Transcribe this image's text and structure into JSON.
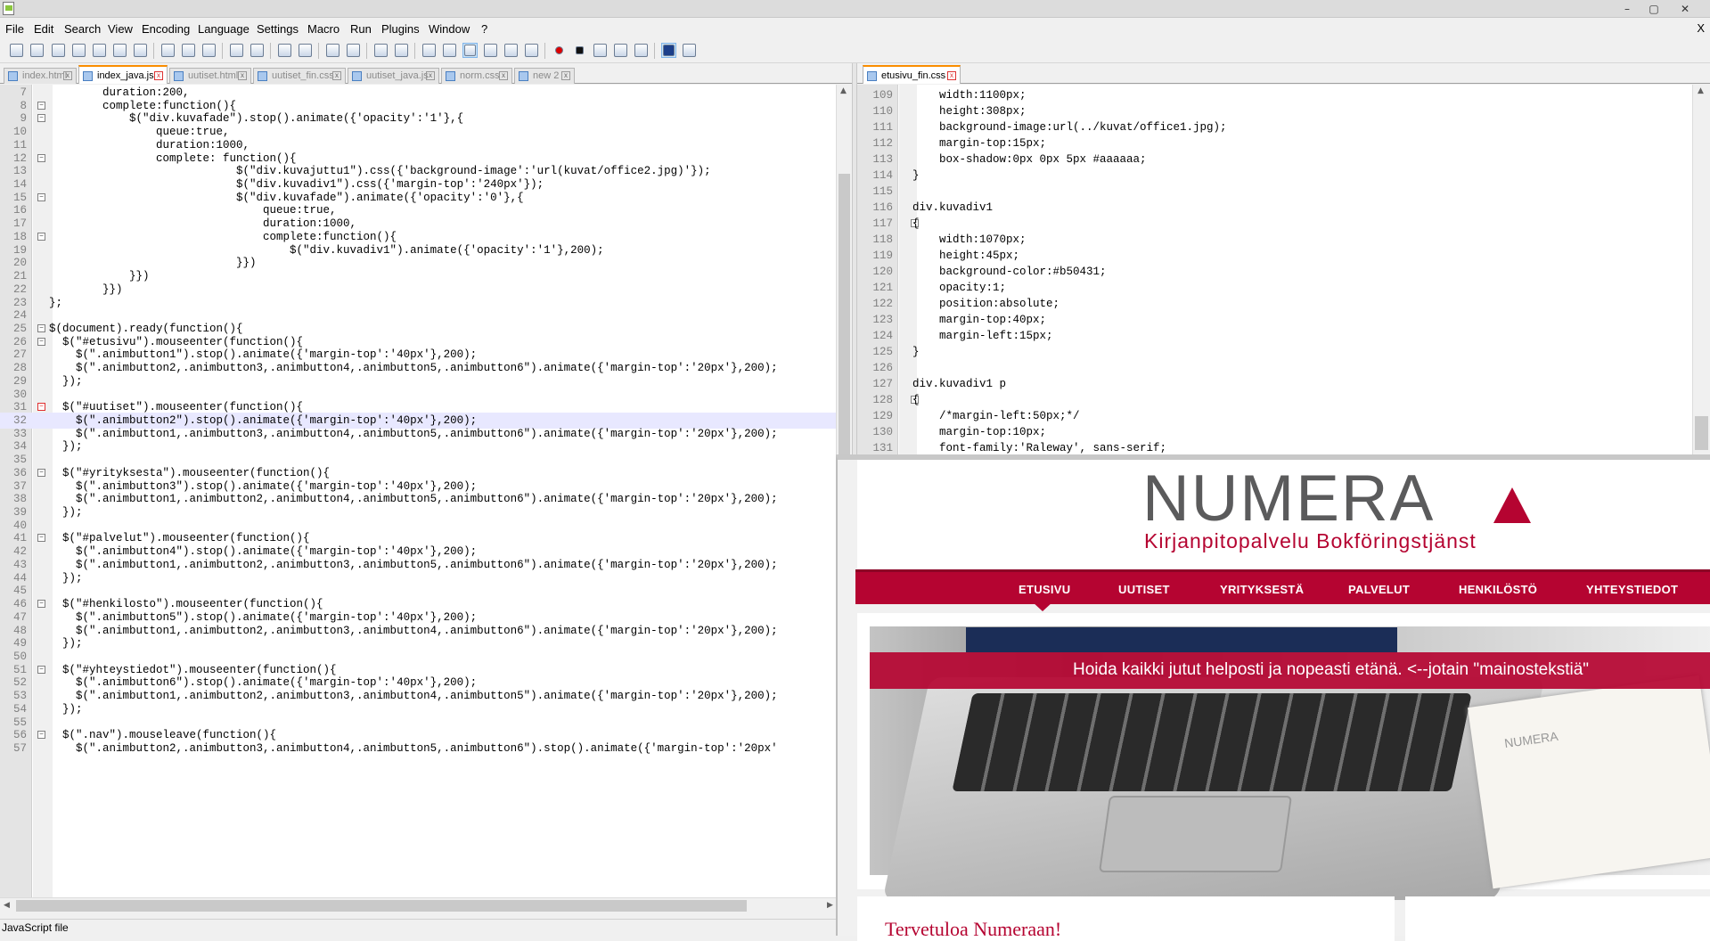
{
  "window": {
    "icon": "notepad-plus-plus-icon",
    "controls": {
      "minimize": "–",
      "maximize": "▢",
      "close": "✕"
    }
  },
  "menubar": {
    "items": [
      "File",
      "Edit",
      "Search",
      "View",
      "Encoding",
      "Language",
      "Settings",
      "Macro",
      "Run",
      "Plugins",
      "Window",
      "?"
    ],
    "close_x": "X"
  },
  "tabs_left": [
    {
      "label": "index.html",
      "active": false
    },
    {
      "label": "index_java.js",
      "active": true
    },
    {
      "label": "uutiset.html",
      "active": false
    },
    {
      "label": "uutiset_fin.css",
      "active": false
    },
    {
      "label": "uutiset_java.js",
      "active": false
    },
    {
      "label": "norm.css",
      "active": false
    },
    {
      "label": "new  2",
      "active": false
    }
  ],
  "tabs_right": [
    {
      "label": "etusivu_fin.css",
      "active": true
    }
  ],
  "left_editor": {
    "lines": [
      {
        "n": "7",
        "t": "        duration:200,"
      },
      {
        "n": "8",
        "t": "        complete:function(){"
      },
      {
        "n": "9",
        "t": "            $(\"div.kuvafade\").stop().animate({'opacity':'1'},{"
      },
      {
        "n": "10",
        "t": "                queue:true,"
      },
      {
        "n": "11",
        "t": "                duration:1000,"
      },
      {
        "n": "12",
        "t": "                complete: function(){"
      },
      {
        "n": "13",
        "t": "                            $(\"div.kuvajuttu1\").css({'background-image':'url(kuvat/office2.jpg)'});"
      },
      {
        "n": "14",
        "t": "                            $(\"div.kuvadiv1\").css({'margin-top':'240px'});"
      },
      {
        "n": "15",
        "t": "                            $(\"div.kuvafade\").animate({'opacity':'0'},{"
      },
      {
        "n": "16",
        "t": "                                queue:true,"
      },
      {
        "n": "17",
        "t": "                                duration:1000,"
      },
      {
        "n": "18",
        "t": "                                complete:function(){"
      },
      {
        "n": "19",
        "t": "                                    $(\"div.kuvadiv1\").animate({'opacity':'1'},200);"
      },
      {
        "n": "20",
        "t": "                            }})"
      },
      {
        "n": "21",
        "t": "            }})"
      },
      {
        "n": "22",
        "t": "        }})"
      },
      {
        "n": "23",
        "t": "};"
      },
      {
        "n": "24",
        "t": ""
      },
      {
        "n": "25",
        "t": "$(document).ready(function(){"
      },
      {
        "n": "26",
        "t": "  $(\"#etusivu\").mouseenter(function(){"
      },
      {
        "n": "27",
        "t": "    $(\".animbutton1\").stop().animate({'margin-top':'40px'},200);"
      },
      {
        "n": "28",
        "t": "    $(\".animbutton2,.animbutton3,.animbutton4,.animbutton5,.animbutton6\").animate({'margin-top':'20px'},200);"
      },
      {
        "n": "29",
        "t": "  });"
      },
      {
        "n": "30",
        "t": ""
      },
      {
        "n": "31",
        "t": "  $(\"#uutiset\").mouseenter(function(){"
      },
      {
        "n": "32",
        "t": "    $(\".animbutton2\").stop().animate({'margin-top':'40px'},200);"
      },
      {
        "n": "33",
        "t": "    $(\".animbutton1,.animbutton3,.animbutton4,.animbutton5,.animbutton6\").animate({'margin-top':'20px'},200);"
      },
      {
        "n": "34",
        "t": "  });"
      },
      {
        "n": "35",
        "t": ""
      },
      {
        "n": "36",
        "t": "  $(\"#yrityksesta\").mouseenter(function(){"
      },
      {
        "n": "37",
        "t": "    $(\".animbutton3\").stop().animate({'margin-top':'40px'},200);"
      },
      {
        "n": "38",
        "t": "    $(\".animbutton1,.animbutton2,.animbutton4,.animbutton5,.animbutton6\").animate({'margin-top':'20px'},200);"
      },
      {
        "n": "39",
        "t": "  });"
      },
      {
        "n": "40",
        "t": ""
      },
      {
        "n": "41",
        "t": "  $(\"#palvelut\").mouseenter(function(){"
      },
      {
        "n": "42",
        "t": "    $(\".animbutton4\").stop().animate({'margin-top':'40px'},200);"
      },
      {
        "n": "43",
        "t": "    $(\".animbutton1,.animbutton2,.animbutton3,.animbutton5,.animbutton6\").animate({'margin-top':'20px'},200);"
      },
      {
        "n": "44",
        "t": "  });"
      },
      {
        "n": "45",
        "t": ""
      },
      {
        "n": "46",
        "t": "  $(\"#henkilosto\").mouseenter(function(){"
      },
      {
        "n": "47",
        "t": "    $(\".animbutton5\").stop().animate({'margin-top':'40px'},200);"
      },
      {
        "n": "48",
        "t": "    $(\".animbutton1,.animbutton2,.animbutton3,.animbutton4,.animbutton6\").animate({'margin-top':'20px'},200);"
      },
      {
        "n": "49",
        "t": "  });"
      },
      {
        "n": "50",
        "t": ""
      },
      {
        "n": "51",
        "t": "  $(\"#yhteystiedot\").mouseenter(function(){"
      },
      {
        "n": "52",
        "t": "    $(\".animbutton6\").stop().animate({'margin-top':'40px'},200);"
      },
      {
        "n": "53",
        "t": "    $(\".animbutton1,.animbutton2,.animbutton3,.animbutton4,.animbutton5\").animate({'margin-top':'20px'},200);"
      },
      {
        "n": "54",
        "t": "  });"
      },
      {
        "n": "55",
        "t": ""
      },
      {
        "n": "56",
        "t": "  $(\".nav\").mouseleave(function(){"
      },
      {
        "n": "57",
        "t": "    $(\".animbutton2,.animbutton3,.animbutton4,.animbutton5,.animbutton6\").stop().animate({'margin-top':'20px'"
      }
    ],
    "fold_lines": [
      "8",
      "9",
      "12",
      "15",
      "18",
      "25",
      "26",
      "31",
      "36",
      "41",
      "46",
      "51",
      "56"
    ],
    "highlighted_line": "32"
  },
  "right_editor": {
    "lines": [
      {
        "n": "109",
        "t": "    width:1100px;"
      },
      {
        "n": "110",
        "t": "    height:308px;"
      },
      {
        "n": "111",
        "t": "    background-image:url(../kuvat/office1.jpg);"
      },
      {
        "n": "112",
        "t": "    margin-top:15px;"
      },
      {
        "n": "113",
        "t": "    box-shadow:0px 0px 5px #aaaaaa;"
      },
      {
        "n": "114",
        "t": "}"
      },
      {
        "n": "115",
        "t": ""
      },
      {
        "n": "116",
        "t": "div.kuvadiv1"
      },
      {
        "n": "117",
        "t": "{"
      },
      {
        "n": "118",
        "t": "    width:1070px;"
      },
      {
        "n": "119",
        "t": "    height:45px;"
      },
      {
        "n": "120",
        "t": "    background-color:#b50431;"
      },
      {
        "n": "121",
        "t": "    opacity:1;"
      },
      {
        "n": "122",
        "t": "    position:absolute;"
      },
      {
        "n": "123",
        "t": "    margin-top:40px;"
      },
      {
        "n": "124",
        "t": "    margin-left:15px;"
      },
      {
        "n": "125",
        "t": "}"
      },
      {
        "n": "126",
        "t": ""
      },
      {
        "n": "127",
        "t": "div.kuvadiv1 p"
      },
      {
        "n": "128",
        "t": "{"
      },
      {
        "n": "129",
        "t": "    /*margin-left:50px;*/"
      },
      {
        "n": "130",
        "t": "    margin-top:10px;"
      },
      {
        "n": "131",
        "t": "    font-family:'Raleway', sans-serif;"
      }
    ],
    "fold_lines": [
      "117",
      "128"
    ]
  },
  "statusbar": {
    "text": "JavaScript file"
  },
  "browser": {
    "logo": "NUMERA",
    "tagline": "Kirjanpitopalvelu  Bokföringstjänst",
    "nav": [
      "ETUSIVU",
      "UUTISET",
      "YRITYKSESTÄ",
      "PALVELUT",
      "HENKILÖSTÖ",
      "YHTEYSTIEDOT"
    ],
    "banner_text": "Hoida kaikki jutut helposti ja nopeasti etänä. <--jotain \"mainostekstiä\"",
    "paper_brand": "NUMERA",
    "welcome": "Tervetuloa Numeraan!",
    "brand_color": "#b50431"
  }
}
